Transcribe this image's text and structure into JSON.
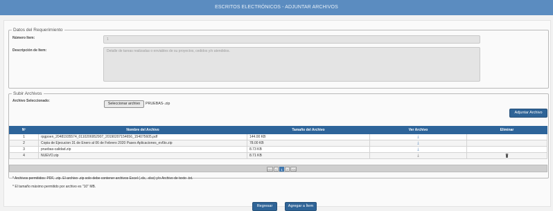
{
  "page": {
    "title": "ESCRITOS ELECTRÓNICOS - ADJUNTAR ARCHIVOS"
  },
  "requerimiento": {
    "legend": "Datos del Requerimiento",
    "item_label": "Número Item:",
    "item_value": "1",
    "desc_label": "Descripción de Item:",
    "desc_value": "Detalle de tareas rea​lizadas o enviables de su proyectos, cedidos y/o atendidos."
  },
  "subir": {
    "legend": "Subir Archivos",
    "selected_label": "Archivo Seleccionado:",
    "select_button": "Seleccionar archivo",
    "selected_file": "PRUEBAS-.zip",
    "attach_button": "Adjuntar Archivo"
  },
  "table": {
    "headers": [
      "Nº",
      "Nombre del Archivo",
      "Tamaño del Archivo",
      "Ver Archivo",
      "Eliminar"
    ],
    "rows": [
      {
        "n": "1",
        "name": "rpgpoen_20481935574_0110206952907_20190207154656_154075605.pdf",
        "size": "144.00 KB",
        "view": "download-icon",
        "delete": ""
      },
      {
        "n": "2",
        "name": "Copia de Ejecucion 31 de Enero al 06 de Febrero 2020 Pases Aplicaciones_ev6to.zip",
        "size": "78.00 KB",
        "view": "download-icon",
        "delete": ""
      },
      {
        "n": "3",
        "name": "pruebas-calidad.zip",
        "size": "8.73 KB",
        "view": "download-icon",
        "delete": ""
      },
      {
        "n": "4",
        "name": "NUEVO.zip",
        "size": "8.71 KB",
        "view": "download-icon",
        "delete": "trash-icon"
      }
    ]
  },
  "pager": {
    "first": "|<<",
    "prev": "<",
    "current": "1",
    "next": ">",
    "last": ">>|"
  },
  "notes": {
    "allowed": "* Archivos permitidos: PDF, .zip. El archivo .zip solo debe contener archivos Excel (.xls, .xlsx) y/o Archivo de texto .txt.",
    "max_size": "* El tamaño máximo permitido por archivo es \"10\" MB."
  },
  "actions": {
    "back": "Regresar",
    "add": "Agregar a Ítem"
  },
  "colors": {
    "header_bar": "#5b8cc0",
    "table_header": "#2d649a",
    "button": "#2f6497"
  }
}
